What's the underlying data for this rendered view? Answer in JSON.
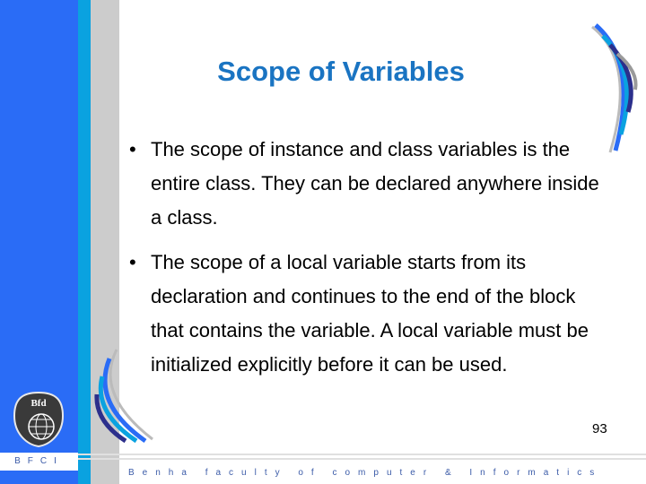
{
  "slide": {
    "title": "Scope of Variables",
    "bullets": [
      "The scope of instance and class variables is the entire class. They can be declared anywhere inside a class.",
      " The scope of a local variable starts from its declaration and continues to the end of the block that contains the variable. A local variable must be initialized explicitly before it can be used."
    ],
    "bullet_symbol": "•",
    "page_number": "93"
  },
  "footer": {
    "badge_text": "BFCI",
    "institution": "Benha faculty of computer & Informatics"
  },
  "colors": {
    "title": "#1a74c2",
    "strip_blue": "#2a6cf6",
    "strip_cyan": "#0aa2e0",
    "strip_gray": "#cccccc",
    "footer_text": "#3b5ba8"
  }
}
